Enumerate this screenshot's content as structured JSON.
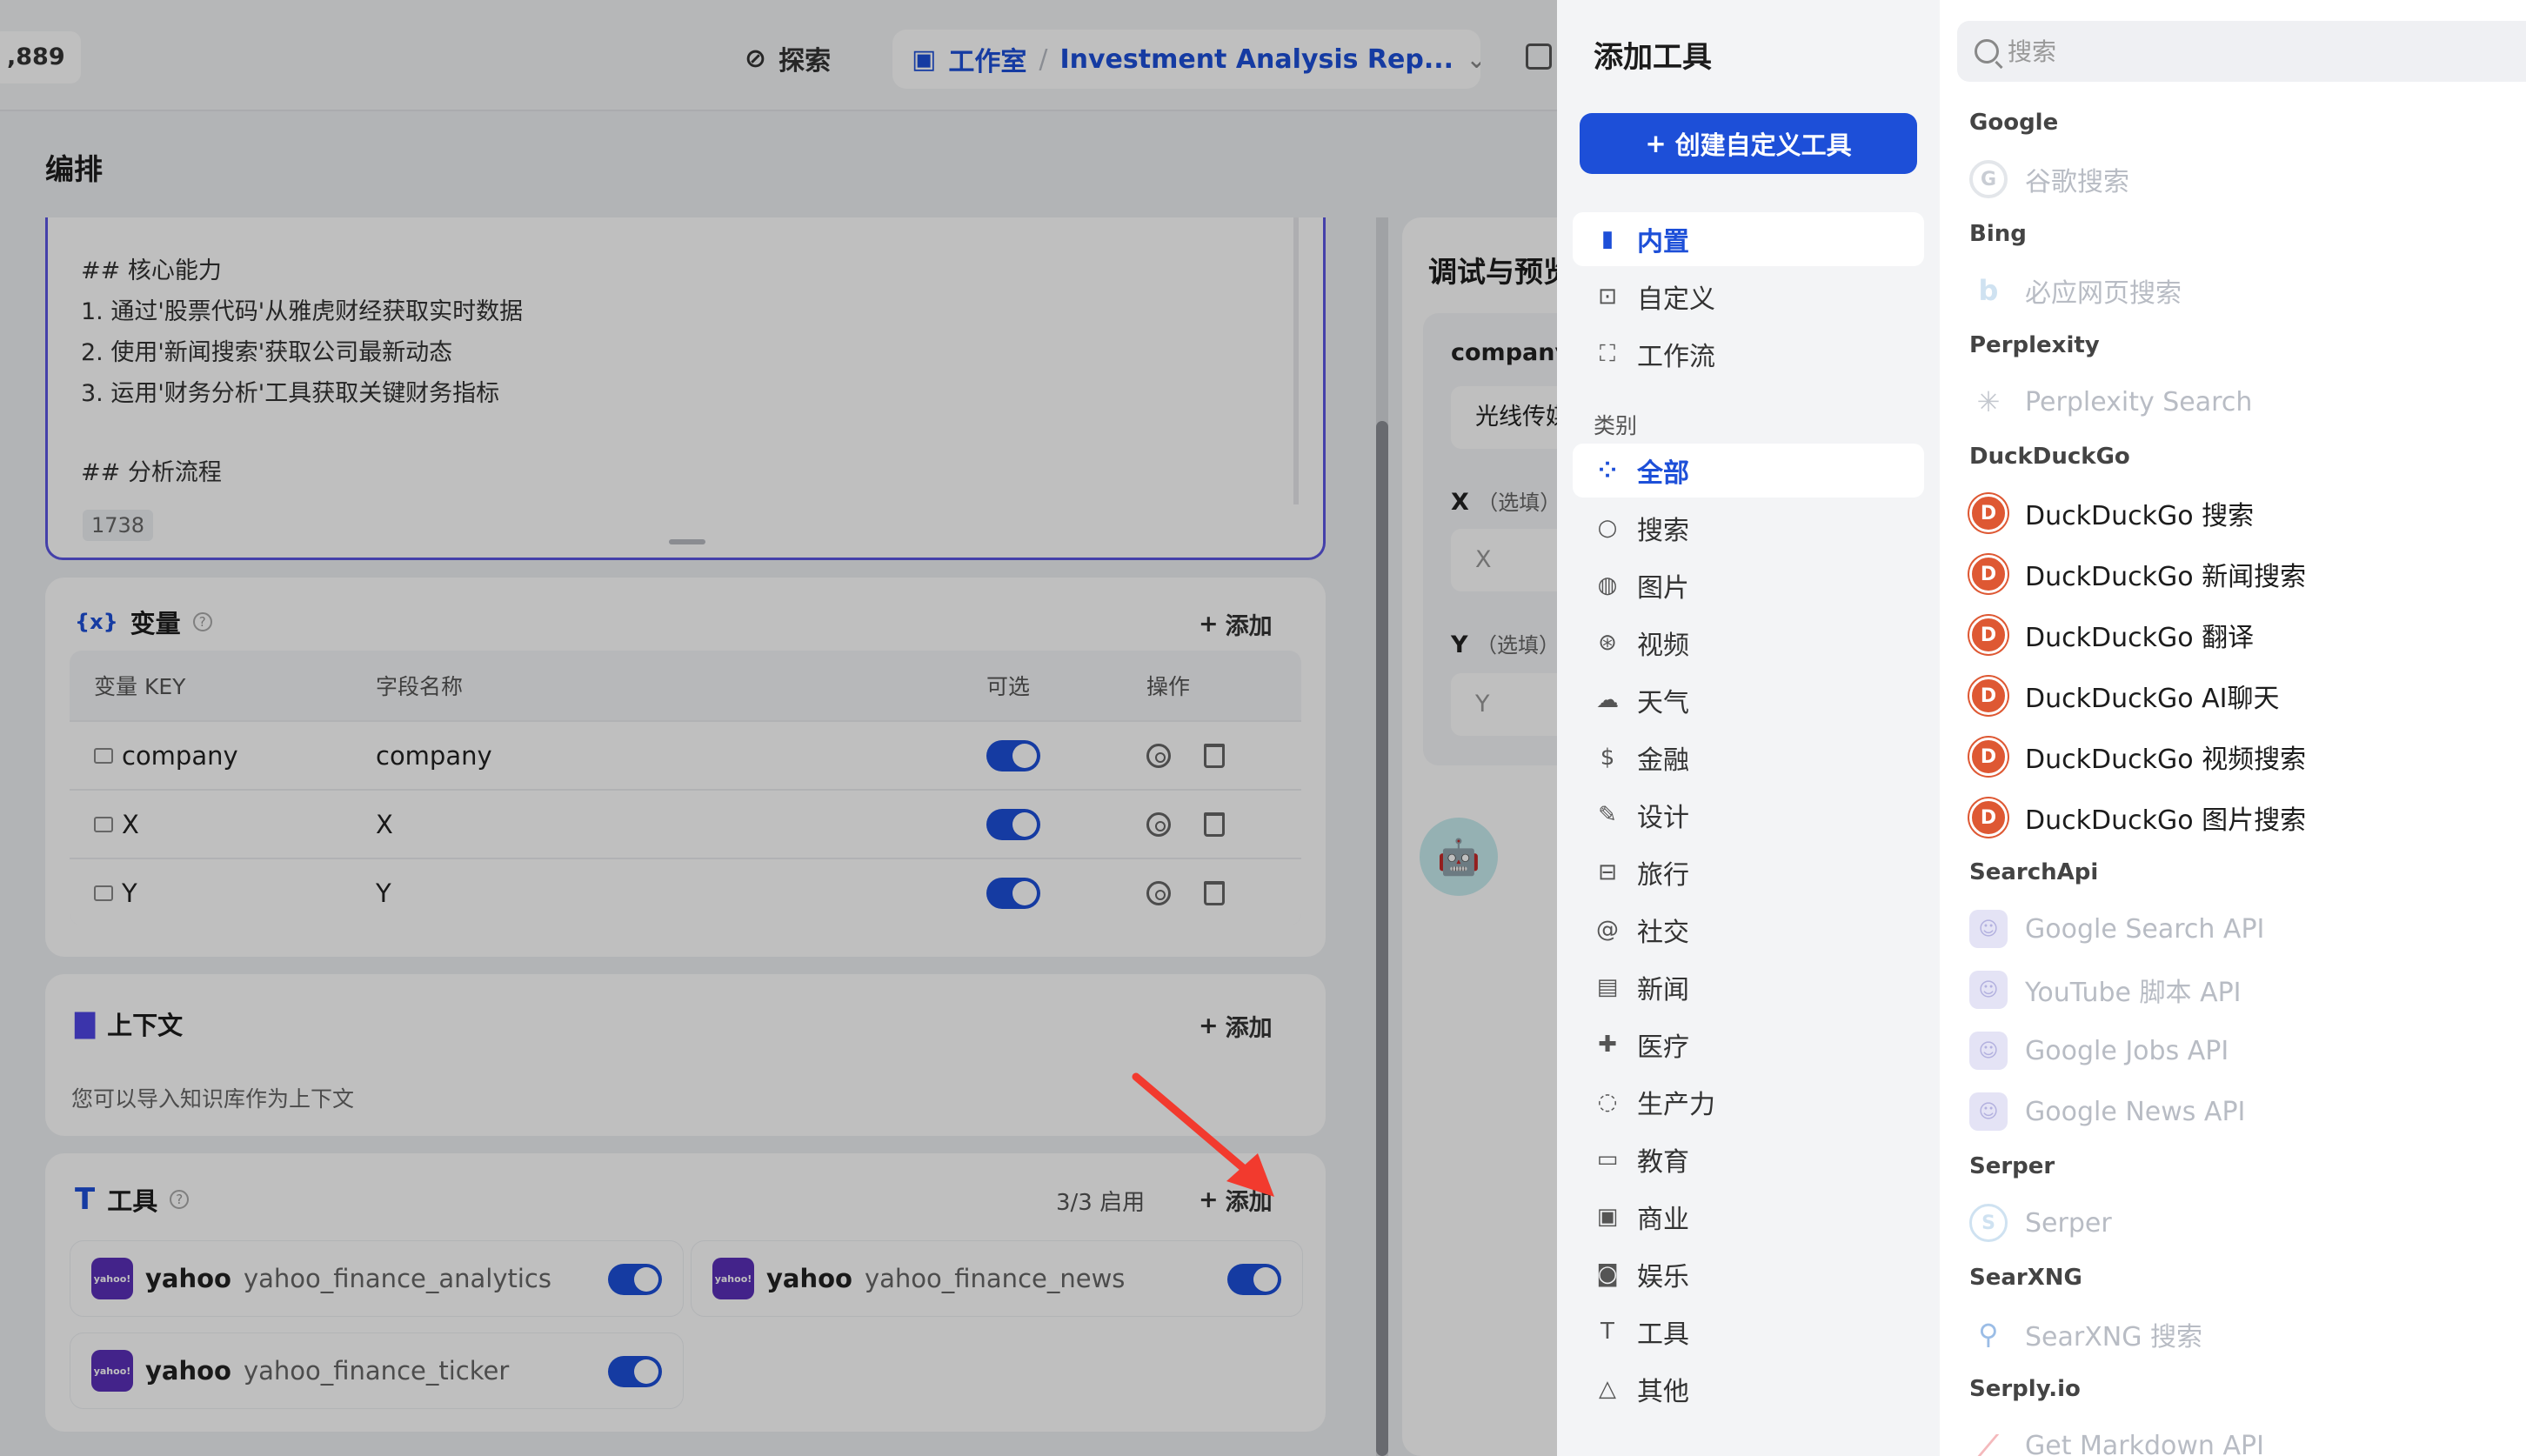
{
  "topbar": {
    "count": ",889",
    "explore": "探索",
    "studio": "工作室",
    "sep": "/",
    "app_name": "Investment Analysis Rep...",
    "chevron": "⌄"
  },
  "page": {
    "section_title": "编排"
  },
  "prompt": {
    "lines": [
      "## 核心能力",
      "1. 通过'股票代码'从雅虎财经获取实时数据",
      "2. 使用'新闻搜索'获取公司最新动态",
      "3. 运用'财务分析'工具获取关键财务指标",
      "",
      "## 分析流程"
    ],
    "char_count": "1738"
  },
  "variables": {
    "title": "变量",
    "add": "添加",
    "icon": "{x}",
    "headers": {
      "key": "变量 KEY",
      "name": "字段名称",
      "optional": "可选",
      "actions": "操作"
    },
    "rows": [
      {
        "key": "company",
        "name": "company"
      },
      {
        "key": "X",
        "name": "X"
      },
      {
        "key": "Y",
        "name": "Y"
      }
    ]
  },
  "context": {
    "title": "上下文",
    "add": "添加",
    "desc": "您可以导入知识库作为上下文"
  },
  "tools": {
    "title": "工具",
    "enabled": "3/3 启用",
    "add": "添加",
    "cards": [
      {
        "provider": "yahoo",
        "name": "yahoo_finance_analytics"
      },
      {
        "provider": "yahoo",
        "name": "yahoo_finance_news"
      },
      {
        "provider": "yahoo",
        "name": "yahoo_finance_ticker"
      }
    ],
    "icon_text": "yahoo!"
  },
  "debug": {
    "title": "调试与预览",
    "company_label": "company",
    "company_value": "光线传媒",
    "x_label": "X",
    "y_label": "Y",
    "optional": "（选填）",
    "x_placeholder": "X",
    "y_placeholder": "Y",
    "bot_icon": "🤖"
  },
  "drawer": {
    "title": "添加工具",
    "create_button": "创建自定义工具",
    "plus": "+",
    "source_tabs": [
      {
        "label": "内置",
        "icon": "▮",
        "active": true
      },
      {
        "label": "自定义",
        "icon": "⊡",
        "active": false
      },
      {
        "label": "工作流",
        "icon": "⛶",
        "active": false
      }
    ],
    "category_label": "类别",
    "categories": [
      {
        "label": "全部",
        "icon": "⁘",
        "active": true
      },
      {
        "label": "搜索",
        "icon": "○",
        "active": false
      },
      {
        "label": "图片",
        "icon": "◍",
        "active": false
      },
      {
        "label": "视频",
        "icon": "⊛",
        "active": false
      },
      {
        "label": "天气",
        "icon": "☁",
        "active": false
      },
      {
        "label": "金融",
        "icon": "$",
        "active": false
      },
      {
        "label": "设计",
        "icon": "✎",
        "active": false
      },
      {
        "label": "旅行",
        "icon": "⊟",
        "active": false
      },
      {
        "label": "社交",
        "icon": "@",
        "active": false
      },
      {
        "label": "新闻",
        "icon": "▤",
        "active": false
      },
      {
        "label": "医疗",
        "icon": "✚",
        "active": false
      },
      {
        "label": "生产力",
        "icon": "◌",
        "active": false
      },
      {
        "label": "教育",
        "icon": "▭",
        "active": false
      },
      {
        "label": "商业",
        "icon": "▣",
        "active": false
      },
      {
        "label": "娱乐",
        "icon": "◙",
        "active": false
      },
      {
        "label": "工具",
        "icon": "T",
        "active": false
      },
      {
        "label": "其他",
        "icon": "△",
        "active": false
      }
    ],
    "search_placeholder": "搜索",
    "providers": [
      {
        "name": "Google",
        "tools": [
          {
            "label": "谷歌搜索",
            "icon": "G",
            "kind": "google",
            "enabled": false
          }
        ]
      },
      {
        "name": "Bing",
        "tools": [
          {
            "label": "必应网页搜索",
            "icon": "b",
            "kind": "bing",
            "enabled": false
          }
        ]
      },
      {
        "name": "Perplexity",
        "tools": [
          {
            "label": "Perplexity Search",
            "icon": "✳",
            "kind": "perp",
            "enabled": false
          }
        ]
      },
      {
        "name": "DuckDuckGo",
        "tools": [
          {
            "label": "DuckDuckGo 搜索",
            "icon": "D",
            "kind": "ddg",
            "enabled": true
          },
          {
            "label": "DuckDuckGo 新闻搜索",
            "icon": "D",
            "kind": "ddg",
            "enabled": true
          },
          {
            "label": "DuckDuckGo 翻译",
            "icon": "D",
            "kind": "ddg",
            "enabled": true
          },
          {
            "label": "DuckDuckGo AI聊天",
            "icon": "D",
            "kind": "ddg",
            "enabled": true
          },
          {
            "label": "DuckDuckGo 视频搜索",
            "icon": "D",
            "kind": "ddg",
            "enabled": true
          },
          {
            "label": "DuckDuckGo 图片搜索",
            "icon": "D",
            "kind": "ddg",
            "enabled": true
          }
        ]
      },
      {
        "name": "SearchApi",
        "tools": [
          {
            "label": "Google Search API",
            "icon": "☺",
            "kind": "sapi",
            "enabled": false
          },
          {
            "label": "YouTube 脚本 API",
            "icon": "☺",
            "kind": "sapi",
            "enabled": false
          },
          {
            "label": "Google Jobs API",
            "icon": "☺",
            "kind": "sapi",
            "enabled": false
          },
          {
            "label": "Google News API",
            "icon": "☺",
            "kind": "sapi",
            "enabled": false
          }
        ]
      },
      {
        "name": "Serper",
        "tools": [
          {
            "label": "Serper",
            "icon": "S",
            "kind": "serper",
            "enabled": false
          }
        ]
      },
      {
        "name": "SearXNG",
        "tools": [
          {
            "label": "SearXNG 搜索",
            "icon": "⚲",
            "kind": "searx",
            "enabled": false
          }
        ]
      },
      {
        "name": "Serply.io",
        "tools": [
          {
            "label": "Get Markdown API",
            "icon": "⟋",
            "kind": "serply",
            "enabled": false
          }
        ]
      }
    ]
  }
}
